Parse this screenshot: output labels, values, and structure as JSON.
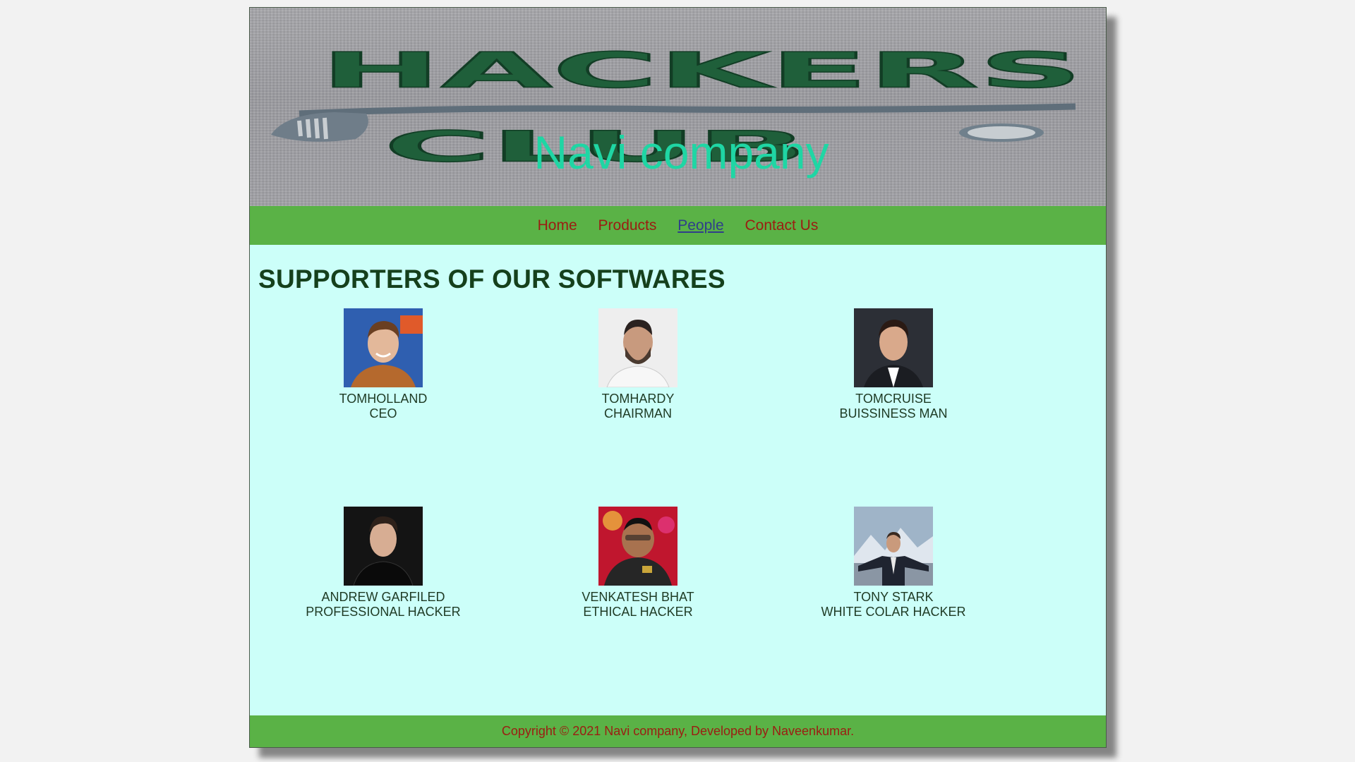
{
  "banner": {
    "logo_text": "HACKERS CLUB",
    "company_title": "Navi company"
  },
  "nav": {
    "items": [
      {
        "label": "Home"
      },
      {
        "label": "Products"
      },
      {
        "label": "People"
      },
      {
        "label": "Contact Us"
      }
    ],
    "active": "People"
  },
  "main": {
    "heading": "SUPPORTERS OF OUR SOFTWARES",
    "people": [
      {
        "name": "TOMHOLLAND",
        "role": "CEO"
      },
      {
        "name": "TOMHARDY",
        "role": "CHAIRMAN"
      },
      {
        "name": "TOMCRUISE",
        "role": "BUISSINESS MAN"
      },
      {
        "name": "ANDREW GARFILED",
        "role": "PROFESSIONAL HACKER"
      },
      {
        "name": "VENKATESH BHAT",
        "role": "ETHICAL HACKER"
      },
      {
        "name": "TONY STARK",
        "role": "WHITE COLAR HACKER"
      }
    ]
  },
  "footer": {
    "text": "Copyright © 2021 Navi company, Developed by Naveenkumar."
  },
  "colors": {
    "nav_bg": "#5ab246",
    "content_bg": "#ccfff9",
    "link": "#9b1d12",
    "active_link": "#2f3e8a",
    "heading": "#15401c",
    "banner_title": "#1fd6a4"
  }
}
